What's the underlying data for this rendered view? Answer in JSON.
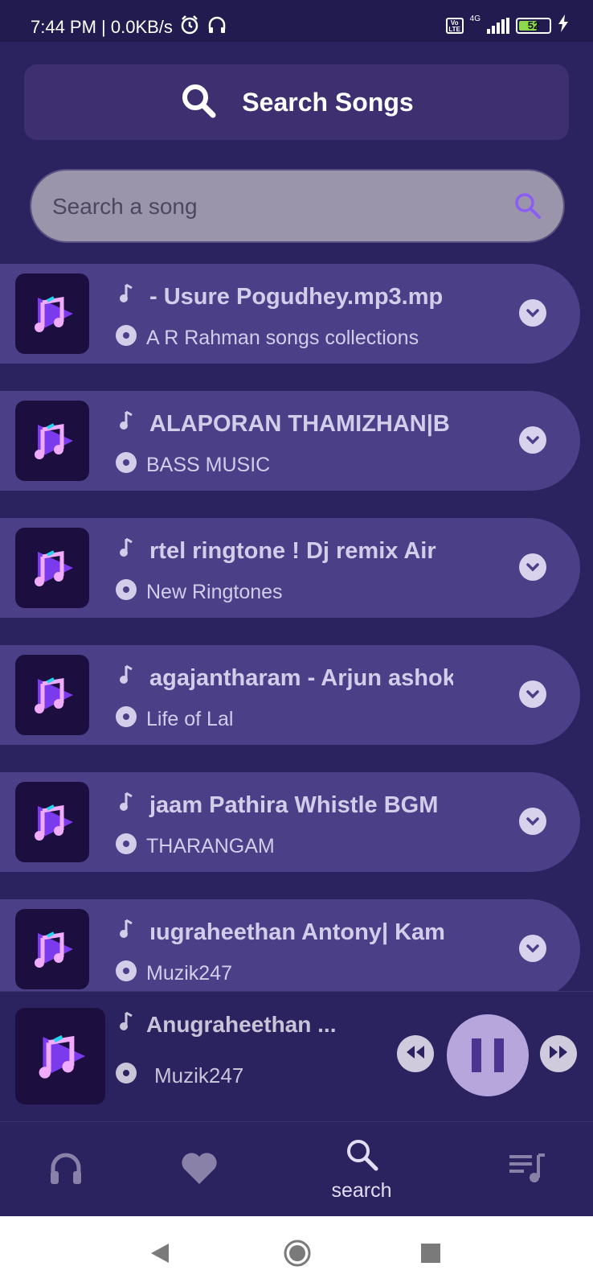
{
  "status_bar": {
    "time": "7:44 PM | 0.0KB/s",
    "network": "4G",
    "battery": "52"
  },
  "header": {
    "title": "Search Songs"
  },
  "search": {
    "placeholder": "Search a song"
  },
  "songs": [
    {
      "title": "- Usure Pogudhey.mp3.mp",
      "album": "A R Rahman songs collections"
    },
    {
      "title": "ALAPORAN THAMIZHAN|B",
      "album": "BASS MUSIC"
    },
    {
      "title": "rtel ringtone  ! Dj remix Air",
      "album": "New Ringtones"
    },
    {
      "title": "agajantharam - Arjun ashok",
      "album": "Life of Lal"
    },
    {
      "title": "jaam Pathira Whistle BGM",
      "album": "THARANGAM"
    },
    {
      "title": "ıugraheethan Antony| Kam",
      "album": "Muzik247"
    }
  ],
  "player": {
    "title": "Anugraheethan ...",
    "album": "Muzik247"
  },
  "nav": {
    "search_label": "search"
  },
  "colors": {
    "background": "#2b2260",
    "card": "#4b3f88",
    "accent": "#8b5cf6"
  }
}
